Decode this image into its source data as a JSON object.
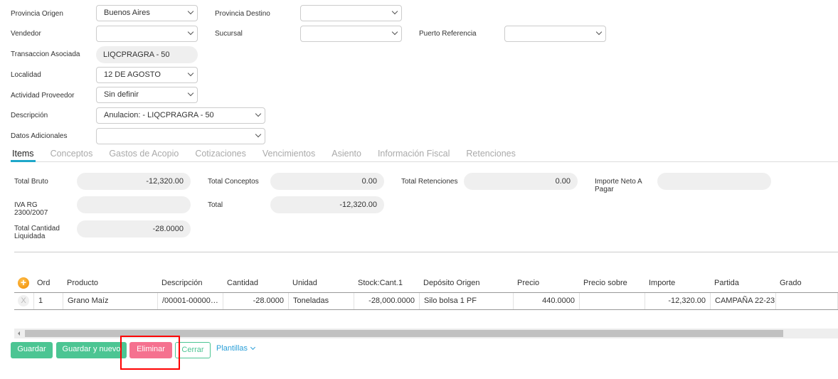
{
  "form": {
    "provincia_origen": {
      "label": "Provincia Origen",
      "value": "Buenos Aires"
    },
    "provincia_destino": {
      "label": "Provincia Destino",
      "value": ""
    },
    "vendedor": {
      "label": "Vendedor",
      "value": ""
    },
    "sucursal": {
      "label": "Sucursal",
      "value": ""
    },
    "puerto_referencia": {
      "label": "Puerto Referencia",
      "value": ""
    },
    "transaccion_asociada": {
      "label": "Transaccion Asociada",
      "value": "LIQCPRAGRA - 50"
    },
    "localidad": {
      "label": "Localidad",
      "value": "12 DE AGOSTO"
    },
    "actividad_proveedor": {
      "label": "Actividad Proveedor",
      "value": "Sin definir"
    },
    "descripcion": {
      "label": "Descripción",
      "value": "Anulacion: - LIQCPRAGRA - 50"
    },
    "datos_adicionales": {
      "label": "Datos Adicionales",
      "value": ""
    }
  },
  "tabs": [
    "Items",
    "Conceptos",
    "Gastos de Acopio",
    "Cotizaciones",
    "Vencimientos",
    "Asiento",
    "Información Fiscal",
    "Retenciones"
  ],
  "totals": {
    "total_bruto": {
      "label": "Total Bruto",
      "value": "-12,320.00"
    },
    "total_conceptos": {
      "label": "Total Conceptos",
      "value": "0.00"
    },
    "total_retenciones": {
      "label": "Total Retenciones",
      "value": "0.00"
    },
    "importe_neto": {
      "label": "Importe Neto A Pagar",
      "value": ""
    },
    "iva_rg": {
      "label": "IVA RG 2300/2007",
      "value": ""
    },
    "total": {
      "label": "Total",
      "value": "-12,320.00"
    },
    "total_cantidad": {
      "label": "Total Cantidad Liquidada",
      "value": "-28.0000"
    }
  },
  "table": {
    "headers": [
      "Ord",
      "Producto",
      "Descripción",
      "Cantidad",
      "Unidad",
      "Stock:Cant.1",
      "Depósito Origen",
      "Precio",
      "Precio sobre",
      "Importe",
      "Partida",
      "Grado"
    ],
    "rows": [
      [
        "1",
        "Grano Maíz",
        "/00001-00000…",
        "-28.0000",
        "Toneladas",
        "-28,000.0000",
        "Silo bolsa 1 PF",
        "440.0000",
        "",
        "-12,320.00",
        "CAMPAÑA 22-23",
        ""
      ]
    ],
    "remove_glyph": "X",
    "add_glyph": "+"
  },
  "buttons": {
    "guardar": "Guardar",
    "guardar_nuevo": "Guardar y nuevo",
    "eliminar": "Eliminar",
    "cerrar": "Cerrar",
    "plantillas": "Plantillas"
  },
  "colors": {
    "green": "#4cc593",
    "pink": "#f5718f",
    "accent": "#1ea7c9",
    "highlight": "#ff0000"
  }
}
